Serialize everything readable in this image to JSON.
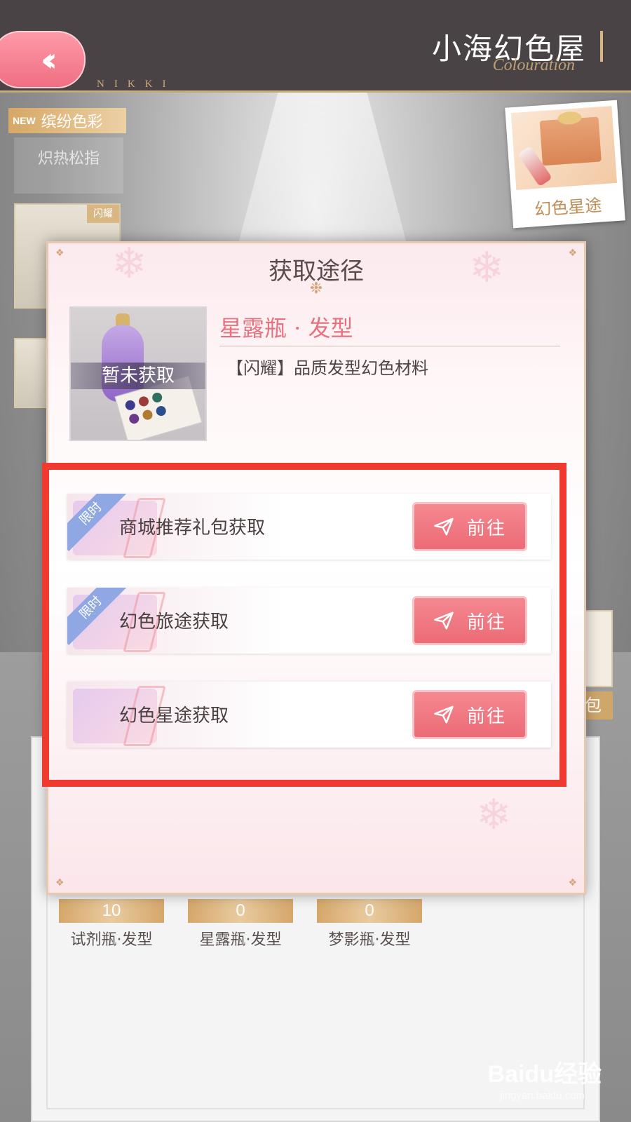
{
  "header": {
    "title": "小海幻色屋",
    "subtitle_script": "Colouration",
    "brand_tag": "NIKKI",
    "back_icon": "double-chevron-left-icon"
  },
  "left_tabs": {
    "new_badge": "NEW",
    "new_label": "缤纷色彩",
    "second_label": "炽热松指",
    "card_badge": "闪耀"
  },
  "promo": {
    "label": "幻色星途"
  },
  "side_tag": "包",
  "modal": {
    "title": "获取途径",
    "item": {
      "name": "星露瓶 · 发型",
      "description": "【闪耀】品质发型幻色材料",
      "status": "暂未获取"
    },
    "sources": [
      {
        "label": "商城推荐礼包获取",
        "limited": "限时",
        "button": "前往",
        "icon": "paper-plane-icon"
      },
      {
        "label": "幻色旅途获取",
        "limited": "限时",
        "button": "前往",
        "icon": "paper-plane-icon"
      },
      {
        "label": "幻色星途获取",
        "limited": "",
        "button": "前往",
        "icon": "paper-plane-icon"
      }
    ]
  },
  "counters": [
    {
      "value": "10",
      "name": "试剂瓶·发型"
    },
    {
      "value": "0",
      "name": "星露瓶·发型"
    },
    {
      "value": "0",
      "name": "梦影瓶·发型"
    }
  ],
  "watermark": {
    "brand": "Baidu经验",
    "url": "jingyan.baidu.com"
  },
  "colors": {
    "accent_pink": "#ec6b76",
    "highlight_red": "#f03a30",
    "gold": "#c9a97a"
  }
}
